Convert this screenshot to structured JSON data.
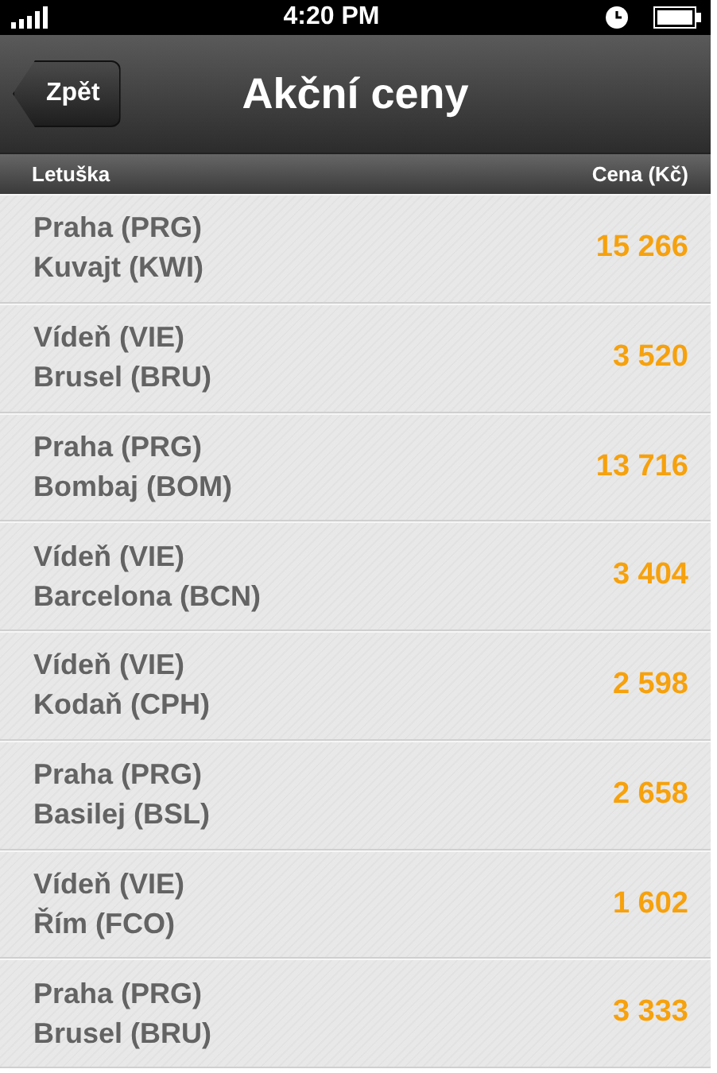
{
  "status_bar": {
    "time": "4:20 PM"
  },
  "nav_bar": {
    "back": "Zpět",
    "title": "Akční ceny"
  },
  "columns": [
    "Letuška",
    "Cena (Kč)"
  ],
  "rows": [
    {
      "from": "Praha (PRG)",
      "to": "Kuvajt (KWI)",
      "price": "15 266"
    },
    {
      "from": "Vídeň (VIE)",
      "to": "Brusel (BRU)",
      "price": "3 520"
    },
    {
      "from": "Praha (PRG)",
      "to": "Bombaj (BOM)",
      "price": "13 716"
    },
    {
      "from": "Vídeň (VIE)",
      "to": "Barcelona (BCN)",
      "price": "3 404"
    },
    {
      "from": "Vídeň (VIE)",
      "to": "Kodaň (CPH)",
      "price": "2 598"
    },
    {
      "from": "Praha (PRG)",
      "to": "Basilej (BSL)",
      "price": "2 658"
    },
    {
      "from": "Vídeň (VIE)",
      "to": "Řím (FCO)",
      "price": "1 602"
    },
    {
      "from": "Praha (PRG)",
      "to": "Brusel (BRU)",
      "price": "3 333"
    }
  ]
}
